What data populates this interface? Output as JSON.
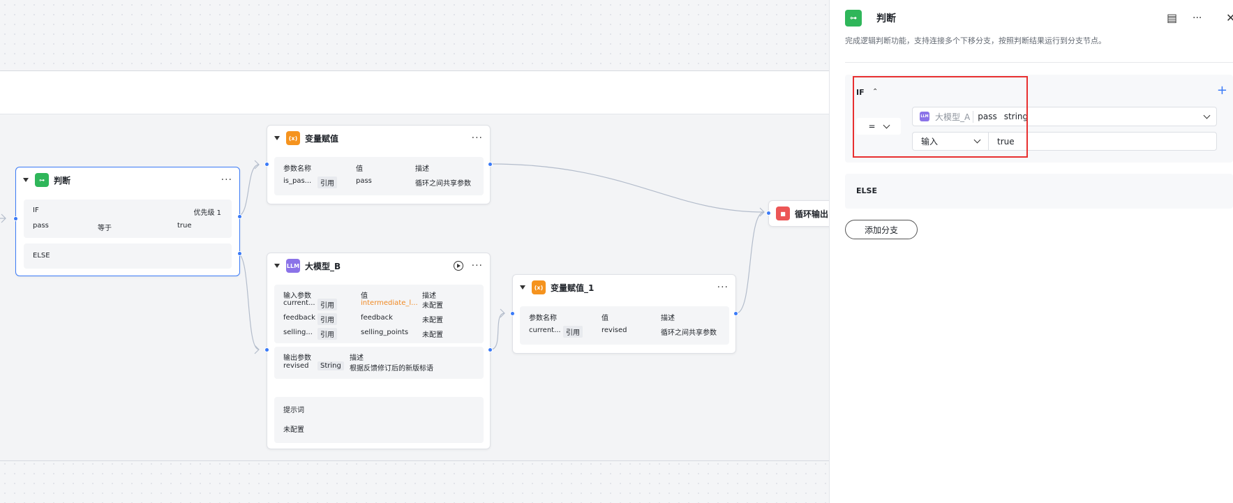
{
  "canvas": {
    "judge_node": {
      "title": "判断",
      "if_label": "IF",
      "priority": "优先级 1",
      "cond_var": "pass",
      "cond_op": "等于",
      "cond_val": "true",
      "else_label": "ELSE"
    },
    "assign_node": {
      "title": "变量赋值",
      "headers": [
        "参数名称",
        "值",
        "描述"
      ],
      "row": {
        "name": "is_pas...",
        "ref": "引用",
        "value": "pass",
        "desc": "循环之间共享参数"
      }
    },
    "llm_node": {
      "title": "大模型_B",
      "input_headers": [
        "输入参数",
        "值",
        "描述"
      ],
      "inputs": [
        {
          "name": "current...",
          "ref": "引用",
          "value": "intermediate_l...",
          "desc": "未配置"
        },
        {
          "name": "feedback",
          "ref": "引用",
          "value": "feedback",
          "desc": "未配置"
        },
        {
          "name": "selling...",
          "ref": "引用",
          "value": "selling_points",
          "desc": "未配置"
        }
      ],
      "output_headers": [
        "输出参数",
        "描述"
      ],
      "output": {
        "name": "revised",
        "type": "String",
        "desc": "根据反馈修订后的新版标语"
      },
      "prompt_label": "提示词",
      "prompt_value": "未配置"
    },
    "assign1_node": {
      "title": "变量赋值_1",
      "headers": [
        "参数名称",
        "值",
        "描述"
      ],
      "row": {
        "name": "current...",
        "ref": "引用",
        "value": "revised",
        "desc": "循环之间共享参数"
      }
    },
    "loop_output_node": {
      "title": "循环输出"
    }
  },
  "panel": {
    "title": "判断",
    "description": "完成逻辑判断功能，支持连接多个下移分支，按照判断结果运行到分支节点。",
    "if_label": "IF",
    "operator": "=",
    "lhs": {
      "source": "大模型_A",
      "var": "pass",
      "type": "string"
    },
    "rhs": {
      "mode": "输入",
      "value": "true"
    },
    "else_label": "ELSE",
    "add_branch": "添加分支",
    "colors": {
      "accent": "#3a7af7",
      "highlight": "#e82f2f"
    }
  }
}
